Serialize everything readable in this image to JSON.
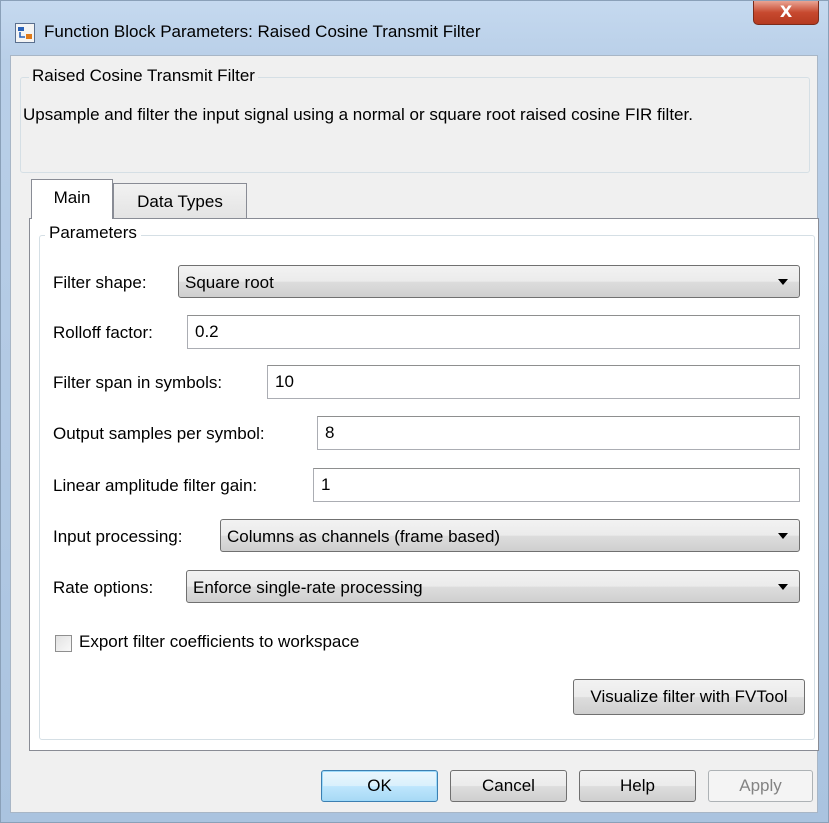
{
  "window": {
    "title": "Function Block Parameters: Raised Cosine Transmit Filter",
    "close_label": "X"
  },
  "description": {
    "group_title": "Raised Cosine Transmit Filter",
    "text": "Upsample and filter the input signal using a normal or square root raised cosine FIR filter."
  },
  "tabs": [
    {
      "label": "Main",
      "selected": true
    },
    {
      "label": "Data Types",
      "selected": false
    }
  ],
  "parameters": {
    "group_title": "Parameters",
    "filter_shape": {
      "label": "Filter shape:",
      "value": "Square root"
    },
    "rolloff_factor": {
      "label": "Rolloff factor:",
      "value": "0.2"
    },
    "filter_span": {
      "label": "Filter span in symbols:",
      "value": "10"
    },
    "output_samples": {
      "label": "Output samples per symbol:",
      "value": "8"
    },
    "filter_gain": {
      "label": "Linear amplitude filter gain:",
      "value": "1"
    },
    "input_processing": {
      "label": "Input processing:",
      "value": "Columns as channels (frame based)"
    },
    "rate_options": {
      "label": "Rate options:",
      "value": "Enforce single-rate processing"
    },
    "export_coefficients": {
      "label": "Export filter coefficients to workspace",
      "checked": false
    },
    "visualize_label": "Visualize filter with FVTool"
  },
  "buttons": {
    "ok": "OK",
    "cancel": "Cancel",
    "help": "Help",
    "apply": "Apply"
  }
}
